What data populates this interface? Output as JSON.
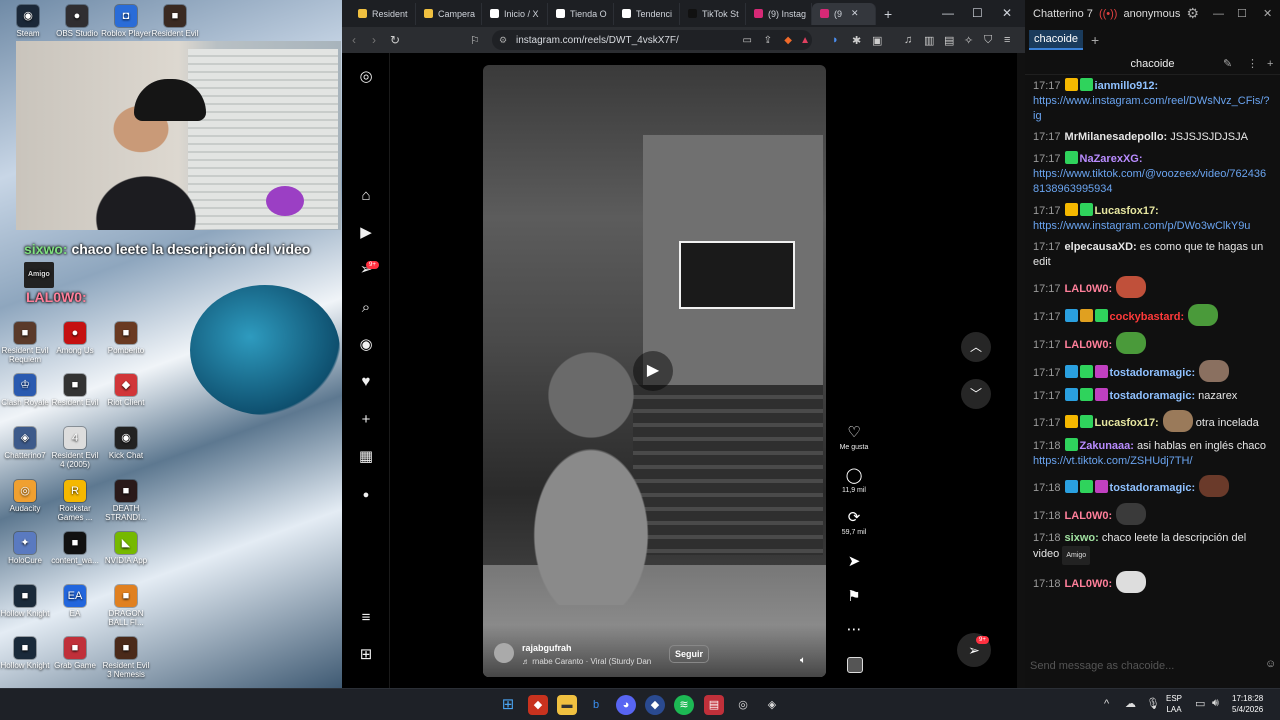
{
  "desktop": {
    "icons": [
      {
        "label": "Steam",
        "color": "#1b2838",
        "glyph": "◉"
      },
      {
        "label": "OBS Studio",
        "color": "#302e31",
        "glyph": "●"
      },
      {
        "label": "Roblox Player",
        "color": "#2a6cd8",
        "glyph": "◘"
      },
      {
        "label": "Resident Evil",
        "color": "#3a2a22",
        "glyph": "■"
      },
      {
        "label": "Resident Evil Requiem",
        "color": "#5a3a2a",
        "glyph": "■"
      },
      {
        "label": "Among Us",
        "color": "#c51111",
        "glyph": "●"
      },
      {
        "label": "Pomberito",
        "color": "#6a3a22",
        "glyph": "■"
      },
      {
        "label": "Clash Royale",
        "color": "#2a5ab0",
        "glyph": "♔"
      },
      {
        "label": "Resident Evil",
        "color": "#333333",
        "glyph": "■"
      },
      {
        "label": "Riot Client",
        "color": "#d13639",
        "glyph": "◆"
      },
      {
        "label": "Chatterino7",
        "color": "#3d5a8a",
        "glyph": "◈"
      },
      {
        "label": "Resident Evil 4 (2005)",
        "color": "#dddddd",
        "glyph": "4"
      },
      {
        "label": "Kick Chat",
        "color": "#222222",
        "glyph": "◉"
      },
      {
        "label": "Audacity",
        "color": "#f0a030",
        "glyph": "◎"
      },
      {
        "label": "Rockstar Games ...",
        "color": "#f5b800",
        "glyph": "R"
      },
      {
        "label": "DEATH STRANDI...",
        "color": "#2a1a1a",
        "glyph": "■"
      },
      {
        "label": "HoloCure",
        "color": "#5a7ac0",
        "glyph": "✦"
      },
      {
        "label": "content_wa...",
        "color": "#111111",
        "glyph": "■"
      },
      {
        "label": "NVIDIA App",
        "color": "#76b900",
        "glyph": "◣"
      },
      {
        "label": "Hollow Knight",
        "color": "#1a2a3a",
        "glyph": "■"
      },
      {
        "label": "EA",
        "color": "#2266dd",
        "glyph": "EA"
      },
      {
        "label": "DRAGON BALL FI...",
        "color": "#e08020",
        "glyph": "■"
      },
      {
        "label": "Hollow Knight",
        "color": "#1a2a3a",
        "glyph": "■"
      },
      {
        "label": "Grab Game",
        "color": "#c0303a",
        "glyph": "■"
      },
      {
        "label": "Resident Evil 3 Nemesis",
        "color": "#4a2a1a",
        "glyph": "■"
      }
    ],
    "overlay": {
      "user": "sixwo:",
      "message": "chaco leete la descripción del video",
      "amigo": "Amigo",
      "user2": "LAL0W0:"
    }
  },
  "browser": {
    "tabs": [
      {
        "label": "Resident",
        "color": "#f0c040"
      },
      {
        "label": "Campera",
        "color": "#f0c040"
      },
      {
        "label": "Inicio / X",
        "color": "#ffffff"
      },
      {
        "label": "Tienda O",
        "color": "#ffffff"
      },
      {
        "label": "Tendenci",
        "color": "#ffffff"
      },
      {
        "label": "TikTok St",
        "color": "#111111"
      },
      {
        "label": "(9) Instag",
        "color": "#d62976"
      },
      {
        "label": "(9",
        "color": "#d62976"
      }
    ],
    "url": "instagram.com/reels/DWT_4vskX7F/",
    "instagram": {
      "badge": "9+",
      "video": {
        "username": "rajabgufrah",
        "song": "rnabe Caranto · Viral (Sturdy Dan",
        "follow": "Seguir"
      },
      "actions": [
        {
          "icon": "♡",
          "label": "Me gusta"
        },
        {
          "icon": "◯",
          "label": "11,9 mil"
        },
        {
          "icon": "⟳",
          "label": "59,7 mil"
        },
        {
          "icon": "➤",
          "label": ""
        },
        {
          "icon": "⚑",
          "label": ""
        },
        {
          "icon": "⋯",
          "label": ""
        }
      ]
    }
  },
  "chatterino": {
    "title": "Chatterino 7",
    "user": "anonymous",
    "tab": "chacoide",
    "channel": "chacoide",
    "placeholder": "Send message as chacoide...",
    "messages": [
      {
        "time": "17:17",
        "user": "ianmillo912:",
        "color": "#8fc1ff",
        "text": "",
        "link": "https://www.instagram.com/reel/DWsNvz_CFis/?ig",
        "badges": [
          "#f5b800",
          "#2fd35c"
        ]
      },
      {
        "time": "17:17",
        "user": "MrMilanesadepollo:",
        "color": "#e6e6e6",
        "text": "JSJSJSJDJSJA",
        "link": "",
        "badges": []
      },
      {
        "time": "17:17",
        "user": "NaZarexXG:",
        "color": "#b98cff",
        "text": "",
        "link": "https://www.tiktok.com/@voozeex/video/7624368138963995934",
        "badges": [
          "#2fd35c"
        ]
      },
      {
        "time": "17:17",
        "user": "Lucasfox17:",
        "color": "#e6e6a0",
        "text": "",
        "link": "https://www.instagram.com/p/DWo3wClkY9u",
        "badges": [
          "#f5b800",
          "#2fd35c"
        ]
      },
      {
        "time": "17:17",
        "user": "elpecausaXD:",
        "color": "#e6e6e6",
        "text": "es como que te hagas un edit",
        "link": "",
        "badges": []
      },
      {
        "time": "17:17",
        "user": "LAL0W0:",
        "color": "#ff7f9a",
        "text": "",
        "link": "",
        "badges": [],
        "emote": "#c0503a"
      },
      {
        "time": "17:17",
        "user": "cockybastard:",
        "color": "#ff3a3a",
        "text": "",
        "link": "",
        "badges": [
          "#2aa0e0",
          "#e0a020",
          "#2fd35c"
        ],
        "emote": "#4a9a3a"
      },
      {
        "time": "17:17",
        "user": "LAL0W0:",
        "color": "#ff7f9a",
        "text": "",
        "link": "",
        "badges": [],
        "emote": "#4a9a3a"
      },
      {
        "time": "17:17",
        "user": "tostadoramagic:",
        "color": "#8fc1ff",
        "text": "",
        "link": "",
        "badges": [
          "#2aa0e0",
          "#2fd35c",
          "#c040c0"
        ],
        "emote": "#8a7060"
      },
      {
        "time": "17:17",
        "user": "tostadoramagic:",
        "color": "#8fc1ff",
        "text": "nazarex",
        "link": "",
        "badges": [
          "#2aa0e0",
          "#2fd35c",
          "#c040c0"
        ]
      },
      {
        "time": "17:17",
        "user": "Lucasfox17:",
        "color": "#e6e6a0",
        "text": "otra incelada",
        "link": "",
        "badges": [
          "#f5b800",
          "#2fd35c"
        ],
        "emote": "#9a7a5a"
      },
      {
        "time": "17:18",
        "user": "Zakunaaa:",
        "color": "#b98cff",
        "text": "asi hablas en inglés chaco",
        "link": "https://vt.tiktok.com/ZSHUdj7TH/",
        "badges": [
          "#2fd35c"
        ]
      },
      {
        "time": "17:18",
        "user": "tostadoramagic:",
        "color": "#8fc1ff",
        "text": "",
        "link": "",
        "badges": [
          "#2aa0e0",
          "#2fd35c",
          "#c040c0"
        ],
        "emote": "#6a3a2a"
      },
      {
        "time": "17:18",
        "user": "LAL0W0:",
        "color": "#ff7f9a",
        "text": "",
        "link": "",
        "badges": [],
        "emote": "#3a3a3a"
      },
      {
        "time": "17:18",
        "user": "sixwo:",
        "color": "#a0e0a0",
        "text": "chaco leete la descripción del video",
        "link": "",
        "badges": [],
        "amigo": "Amigo"
      },
      {
        "time": "17:18",
        "user": "LAL0W0:",
        "color": "#ff7f9a",
        "text": "",
        "link": "",
        "badges": [],
        "emote": "#dddddd"
      }
    ]
  },
  "taskbar": {
    "lang": "ESP",
    "lang2": "LAA",
    "time": "17:18:28",
    "date": "5/4/2026"
  }
}
